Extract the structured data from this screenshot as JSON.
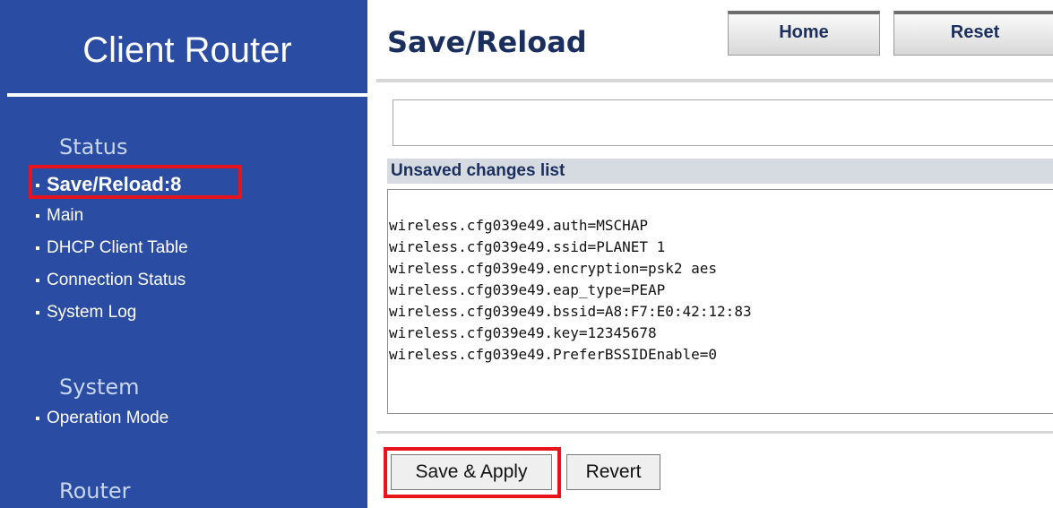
{
  "sidebar": {
    "brand": "Client Router",
    "sections": [
      {
        "title": "Status",
        "items": [
          "Save/Reload:8",
          "Main",
          "DHCP Client Table",
          "Connection Status",
          "System Log"
        ]
      },
      {
        "title": "System",
        "items": [
          "Operation Mode"
        ]
      },
      {
        "title": "Router",
        "items": []
      }
    ]
  },
  "header": {
    "title": "Save/Reload",
    "home_label": "Home",
    "reset_label": "Reset"
  },
  "main": {
    "message": "",
    "changes_header": "Unsaved changes list",
    "changes": [
      "wireless.cfg039e49.auth=MSCHAP",
      "wireless.cfg039e49.ssid=PLANET 1",
      "wireless.cfg039e49.encryption=psk2 aes",
      "wireless.cfg039e49.eap_type=PEAP",
      "wireless.cfg039e49.bssid=A8:F7:E0:42:12:83",
      "wireless.cfg039e49.key=12345678",
      "wireless.cfg039e49.PreferBSSIDEnable=0"
    ],
    "save_apply_label": "Save & Apply",
    "revert_label": "Revert"
  },
  "colors": {
    "sidebar_bg": "#2a4da3",
    "highlight": "#e8141c",
    "title_text": "#1b2f5e"
  }
}
